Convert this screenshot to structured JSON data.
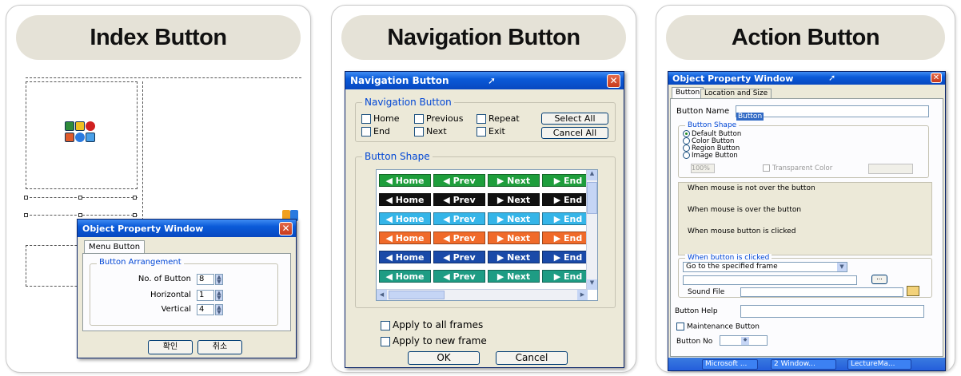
{
  "panels": {
    "index": {
      "title": "Index Button",
      "dialog": {
        "title": "Object Property Window",
        "tab": "Menu Button",
        "group_label": "Button Arrangement",
        "fields": [
          {
            "label": "No. of Button",
            "value": "8"
          },
          {
            "label": "Horizontal",
            "value": "1"
          },
          {
            "label": "Vertical",
            "value": "4"
          }
        ],
        "ok_label": "확인",
        "cancel_label": "취소"
      }
    },
    "navigation": {
      "title": "Navigation Button",
      "dialog": {
        "title": "Navigation Button",
        "nav_group_label": "Navigation Button",
        "checkboxes_row1": [
          "Home",
          "Previous",
          "Repeat"
        ],
        "checkboxes_row2": [
          "End",
          "Next",
          "Exit"
        ],
        "select_all_label": "Select All",
        "cancel_all_label": "Cancel All",
        "shape_group_label": "Button Shape",
        "nav_labels": [
          "◀ Home",
          "◀ Prev",
          "▶ Next",
          "▶ End"
        ],
        "row_colors": [
          "#1e9e3c",
          "#111111",
          "#35b5e8",
          "#f06a2a",
          "#1a4aa8",
          "#1e9c84"
        ],
        "apply_all_frames": "Apply to all frames",
        "apply_new_frame": "Apply to new frame",
        "ok_label": "OK",
        "cancel_label": "Cancel"
      }
    },
    "action": {
      "title": "Action Button",
      "dialog": {
        "title": "Object Property Window",
        "tabs": [
          "Button",
          "Location and Size"
        ],
        "button_name_label": "Button Name",
        "button_name_value": "Button",
        "shape_group_label": "Button Shape",
        "shape_options": [
          "Default Button",
          "Color Button",
          "Region Button",
          "Image Button"
        ],
        "percent_value": "100%",
        "transparent_color_label": "Transparent Color",
        "states": [
          "When mouse is not over the button",
          "When mouse is over the button",
          "When mouse button is clicked"
        ],
        "clicked_group_label": "When button is clicked",
        "action_select_value": "Go to the specified frame",
        "browse_label": "...",
        "sound_file_label": "Sound File",
        "button_help_label": "Button Help",
        "maintenance_label": "Maintenance Button",
        "button_no_label": "Button No"
      },
      "taskbar": [
        "Microsoft ...",
        "2 Window...",
        "LectureMa..."
      ]
    }
  }
}
